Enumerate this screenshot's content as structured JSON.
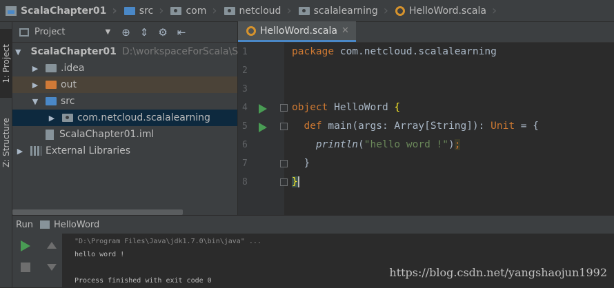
{
  "breadcrumb": [
    "ScalaChapter01",
    "src",
    "com",
    "netcloud",
    "scalalearning",
    "HelloWord.scala"
  ],
  "left_tabs": {
    "project": "1: Project",
    "structure": "Z: Structure"
  },
  "project_panel": {
    "title": "Project",
    "tree": {
      "root": {
        "label": "ScalaChapter01",
        "path": "D:\\workspaceForScala\\S"
      },
      "idea": ".idea",
      "out": "out",
      "src": "src",
      "package": "com.netcloud.scalalearning",
      "iml": "ScalaChapter01.iml",
      "libs": "External Libraries"
    }
  },
  "editor": {
    "tab": "HelloWord.scala",
    "line_numbers": [
      "1",
      "2",
      "3",
      "4",
      "5",
      "6",
      "7",
      "8"
    ],
    "code": {
      "l1_kw": "package",
      "l1_rest": " com.netcloud.scalalearning",
      "l4_kw": "object",
      "l4_name": " HelloWord ",
      "l4_brace": "{",
      "l5_kw": "def",
      "l5_a": " main(args: Array[",
      "l5_type": "String",
      "l5_b": "]): ",
      "l5_unit": "Unit",
      "l5_c": " = {",
      "l6_fn": "println",
      "l6_open": "(",
      "l6_str": "\"hello word !\"",
      "l6_close": ")",
      "l6_semi": ";",
      "l7": "}",
      "l8": "}"
    }
  },
  "run_panel": {
    "label": "Run",
    "config": "HelloWord",
    "console": [
      "\"D:\\Program Files\\Java\\jdk1.7.0\\bin\\java\" ...",
      "hello word !",
      "",
      "Process finished with exit code 0"
    ]
  },
  "watermark": "https://blog.csdn.net/yangshaojun1992",
  "colors": {
    "background": "#2b2b2b",
    "panel": "#3c3f41",
    "keyword": "#cc7832",
    "string": "#6a8759",
    "selection": "#0d293e",
    "run_green": "#499c54"
  }
}
